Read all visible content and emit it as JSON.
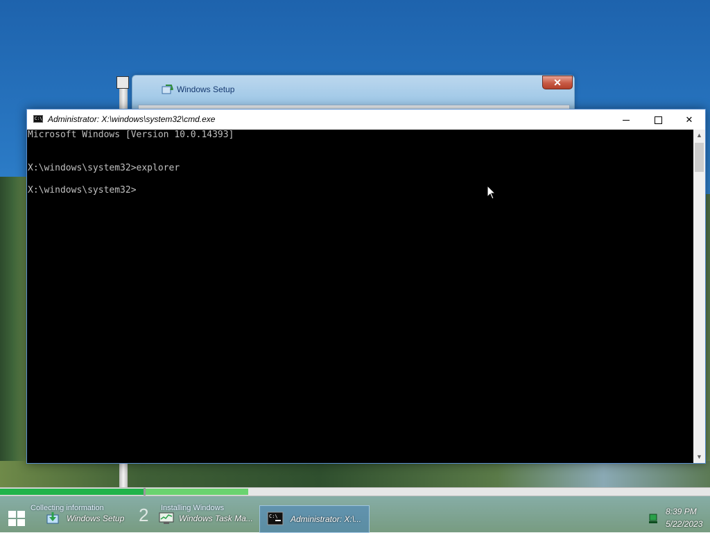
{
  "setup_window": {
    "title": "Windows Setup",
    "close_glyph": "✕"
  },
  "cmd": {
    "title": "Administrator: X:\\windows\\system32\\cmd.exe",
    "icon_text": "C:\\",
    "lines": [
      "Microsoft Windows [Version 10.0.14393]",
      "",
      "",
      "X:\\windows\\system32>explorer",
      "",
      "X:\\windows\\system32>"
    ],
    "close_glyph": "✕",
    "scroll_up": "▲",
    "scroll_down": "▼"
  },
  "setup_progress": {
    "step1_label": "Collecting information",
    "step2_number": "2",
    "step2_label": "Installing Windows",
    "step1_fraction": 1.0,
    "step2_fraction": 0.22
  },
  "taskbar": {
    "items": [
      {
        "label": "Windows Setup",
        "icon": "setup-icon"
      },
      {
        "label": "Windows Task Ma...",
        "icon": "task-manager-icon"
      },
      {
        "label": "Administrator: X:\\...",
        "icon": "cmd-icon",
        "active": true
      }
    ],
    "tray_icon": "network-icon",
    "clock_time": "8:39 PM",
    "clock_date": "5/22/2023"
  },
  "colors": {
    "console_bg": "#000000",
    "console_fg": "#c0c0c0",
    "progress_done": "#21b34a",
    "progress_active": "#6ad36f",
    "active_border": "#5a8fd0"
  }
}
